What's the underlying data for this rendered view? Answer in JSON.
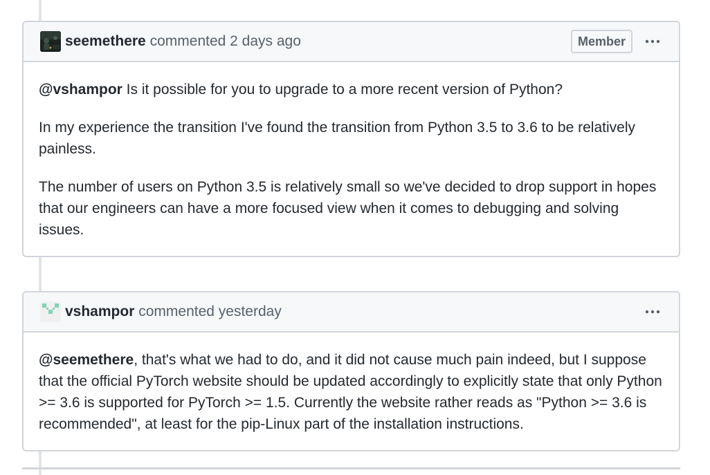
{
  "comments": [
    {
      "author": "seemethere",
      "action": "commented",
      "time": "2 days ago",
      "badge": "Member",
      "avatar_icon": "dark-photo-avatar",
      "paragraphs": [
        {
          "mention": "@vshampor",
          "text": " Is it possible for you to upgrade to a more recent version of Python?"
        },
        {
          "mention": "",
          "text": "In my experience the transition I've found the transition from Python 3.5 to 3.6 to be relatively painless."
        },
        {
          "mention": "",
          "text": "The number of users on Python 3.5 is relatively small so we've decided to drop support in hopes that our engineers can have a more focused view when it comes to debugging and solving issues."
        }
      ]
    },
    {
      "author": "vshampor",
      "action": "commented",
      "time": "yesterday",
      "badge": "",
      "avatar_icon": "identicon-avatar",
      "paragraphs": [
        {
          "mention": "@seemethere",
          "text": ", that's what we had to do, and it did not cause much pain indeed, but I suppose that the official PyTorch website should be updated accordingly to explicitly state that only Python >= 3.6 is supported for PyTorch >= 1.5. Currently the website rather reads as \"Python >= 3.6 is recommended\", at least for the pip-Linux part of the installation instructions."
        }
      ]
    }
  ],
  "colors": {
    "header_bg": "#f6f8fa",
    "border": "#d1d5da",
    "text": "#24292e",
    "meta": "#586069",
    "identicon": "#7ed6b4"
  }
}
